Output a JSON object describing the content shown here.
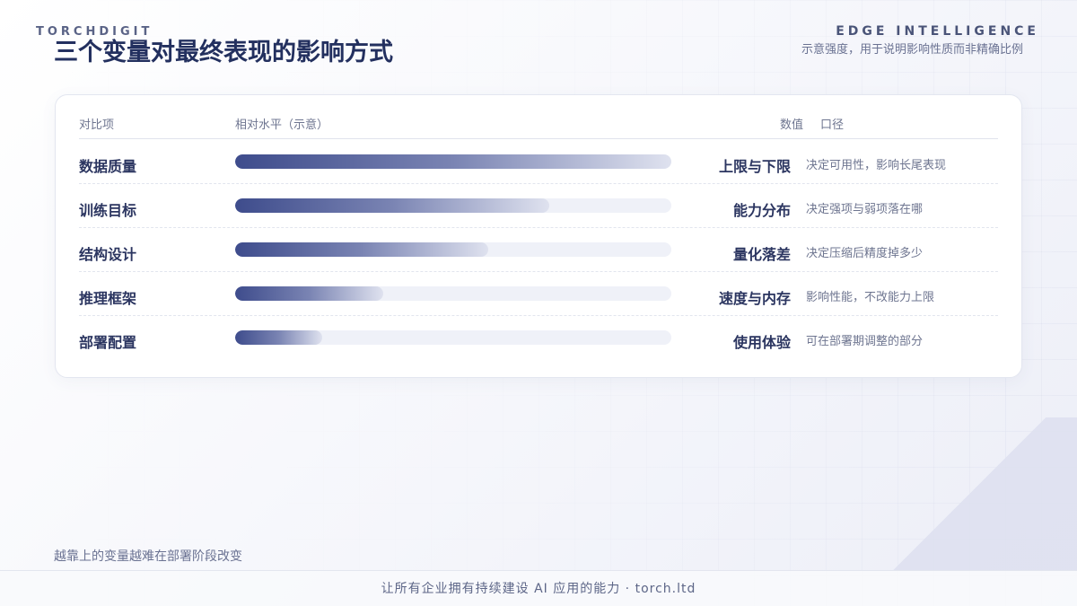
{
  "brand": {
    "left": "TORCHDIGIT",
    "right": "EDGE INTELLIGENCE"
  },
  "header": {
    "title": "三个变量对最终表现的影响方式",
    "subtitle": "示意强度，用于说明影响性质而非精确比例"
  },
  "chart_data": {
    "type": "bar",
    "orientation": "horizontal",
    "columns": {
      "item": "对比项",
      "level": "相对水平（示意）",
      "value": "数值",
      "note": "口径"
    },
    "categories": [
      "数据质量",
      "训练目标",
      "结构设计",
      "推理框架",
      "部署配置"
    ],
    "values": [
      100,
      72,
      58,
      34,
      20
    ],
    "xlim": [
      0,
      100
    ],
    "value_labels": [
      "上限与下限",
      "能力分布",
      "量化落差",
      "速度与内存",
      "使用体验"
    ],
    "notes": [
      "决定可用性，影响长尾表现",
      "决定强项与弱项落在哪",
      "决定压缩后精度掉多少",
      "影响性能，不改能力上限",
      "可在部署期调整的部分"
    ],
    "colors": {
      "bar_start": "#3e4c8c",
      "bar_end": "#dfe2ef",
      "track": "#eff1f8"
    },
    "grid": false
  },
  "footnote": "越靠上的变量越难在部署阶段改变",
  "footer": "让所有企业拥有持续建设 AI 应用的能力 · torch.ltd"
}
